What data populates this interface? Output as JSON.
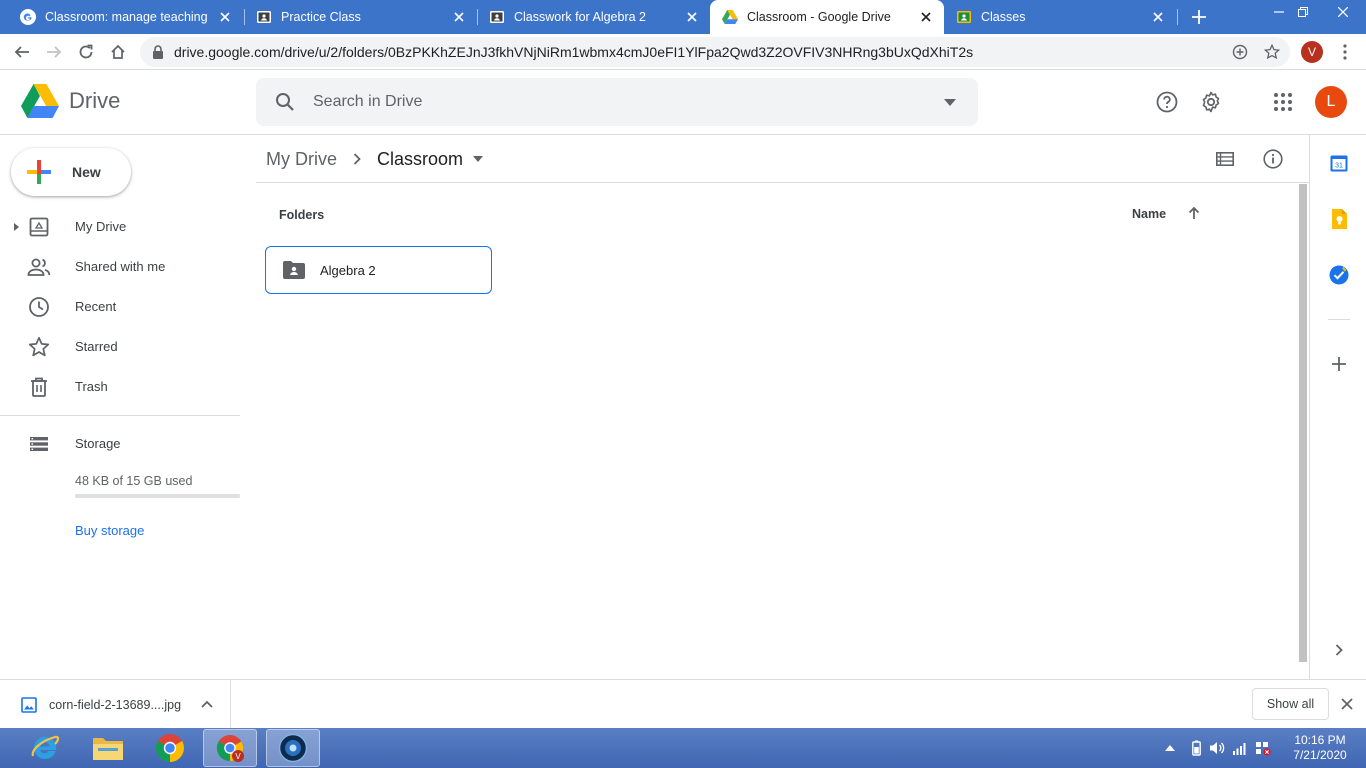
{
  "browser": {
    "tabs": [
      {
        "title": "Classroom: manage teaching an",
        "favicon": "google-g-icon"
      },
      {
        "title": "Practice Class",
        "favicon": "classroom-icon"
      },
      {
        "title": "Classwork for Algebra 2",
        "favicon": "classroom-icon"
      },
      {
        "title": "Classroom - Google Drive",
        "favicon": "drive-icon",
        "active": true
      },
      {
        "title": "Classes",
        "favicon": "classroom-yellow-icon"
      }
    ],
    "url": "drive.google.com/drive/u/2/folders/0BzPKKhZEJnJ3fkhVNjNiRm1wbmx4cmJ0eFI1YlFpa2Qwd3Z2OVFIV3NHRng3bUxQdXhiT2s",
    "profile_initial": "V"
  },
  "header": {
    "app_name": "Drive",
    "search_placeholder": "Search in Drive",
    "avatar_initial": "L"
  },
  "sidebar": {
    "new_label": "New",
    "items": [
      {
        "label": "My Drive",
        "icon": "my-drive-icon"
      },
      {
        "label": "Shared with me",
        "icon": "shared-icon"
      },
      {
        "label": "Recent",
        "icon": "clock-icon"
      },
      {
        "label": "Starred",
        "icon": "star-icon"
      },
      {
        "label": "Trash",
        "icon": "trash-icon"
      }
    ],
    "storage_label": "Storage",
    "storage_used_text": "48 KB of 15 GB used",
    "storage_used_fraction": 0.0,
    "buy_storage_label": "Buy storage"
  },
  "main": {
    "breadcrumb": [
      {
        "label": "My Drive"
      },
      {
        "label": "Classroom"
      }
    ],
    "folders_heading": "Folders",
    "sort_label": "Name",
    "folders": [
      {
        "name": "Algebra 2",
        "icon": "shared-folder-icon"
      }
    ]
  },
  "download_bar": {
    "file_name": "corn-field-2-13689....jpg",
    "show_all_label": "Show all"
  },
  "taskbar": {
    "time": "10:16 PM",
    "date": "7/21/2020"
  },
  "colors": {
    "accent": "#1a73e8",
    "tabstrip": "#3c74c9",
    "avatar": "#e8490f",
    "profile": "#b8311e"
  }
}
